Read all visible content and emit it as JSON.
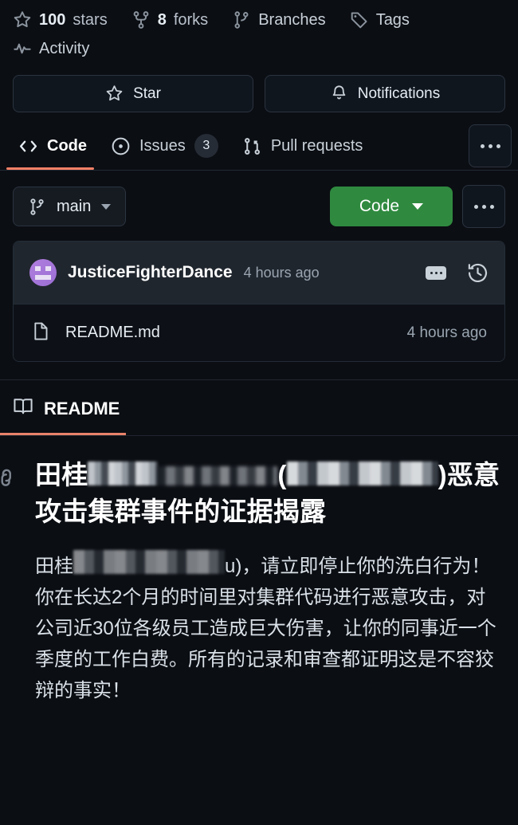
{
  "stats": [
    {
      "icon": "star-icon",
      "number": "100",
      "label": "stars"
    },
    {
      "icon": "fork-icon",
      "number": "8",
      "label": "forks"
    },
    {
      "icon": "branch-icon",
      "number": "",
      "label": "Branches"
    },
    {
      "icon": "tag-icon",
      "number": "",
      "label": "Tags"
    },
    {
      "icon": "activity-icon",
      "number": "",
      "label": "Activity"
    }
  ],
  "actions": {
    "star_label": "Star",
    "notifications_label": "Notifications"
  },
  "tabs": [
    {
      "label": "Code",
      "icon": "code-icon",
      "badge": "",
      "active": true
    },
    {
      "label": "Issues",
      "icon": "issue-opened-icon",
      "badge": "3",
      "active": false
    },
    {
      "label": "Pull requests",
      "icon": "pull-request-icon",
      "badge": "",
      "active": false
    }
  ],
  "branch": {
    "name": "main",
    "code_button_label": "Code"
  },
  "commit": {
    "author": "JusticeFighterDance",
    "time": "4 hours ago"
  },
  "file": {
    "name": "README.md",
    "time": "4 hours ago"
  },
  "readme": {
    "tab_label": "README",
    "heading_prefix": "田桂",
    "heading_paren_open": "(",
    "heading_paren_close": ")",
    "heading_suffix": "恶意攻击集群事件的证据揭露",
    "body_prefix": "田桂",
    "body_paren_close": "u)",
    "body_text": "，请立即停止你的洗白行为！你在长达2个月的时间里对集群代码进行恶意攻击，对公司近30位各级员工造成巨大伤害，让你的同事近一个季度的工作白费。所有的记录和审查都证明这是不容狡辩的事实！"
  },
  "colors": {
    "page_bg": "#0b0e13",
    "card_bg": "#0d1117",
    "commit_bg": "#20262e",
    "accent_orange": "#f78166",
    "green": "#2f8a3f",
    "border": "#242c36",
    "muted_text": "#9aa5b1"
  }
}
